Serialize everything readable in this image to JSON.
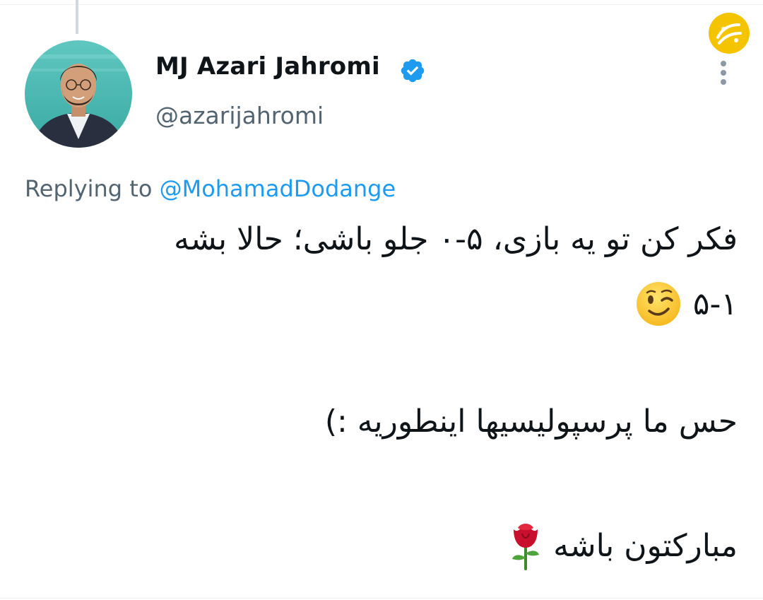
{
  "tweet": {
    "author": {
      "display_name": "MJ Azari Jahromi",
      "handle": "@azarijahromi",
      "verified": true,
      "avatar_icon": "profile-photo"
    },
    "reply_context": {
      "prefix": "Replying to",
      "mention": "@MohamadDodange"
    },
    "body_lines": [
      "فکر کن تو یه بازی، ۵-۰ جلو باشی؛ حالا بشه",
      "۵-۱",
      "حس ما پرسپولیسیها اینطوریه :)",
      "مبارکتون باشه"
    ],
    "emojis": {
      "line2": "winking-face",
      "line4": "rose"
    }
  },
  "ui": {
    "more_icon": "more-vertical-icon",
    "verified_icon": "verified-badge-icon",
    "watermark_icon": "site-logo-icon"
  },
  "colors": {
    "text_primary": "#0f1419",
    "text_secondary": "#536471",
    "link": "#1d9bf0",
    "verified": "#1d9bf0",
    "watermark": "#f5c400"
  }
}
